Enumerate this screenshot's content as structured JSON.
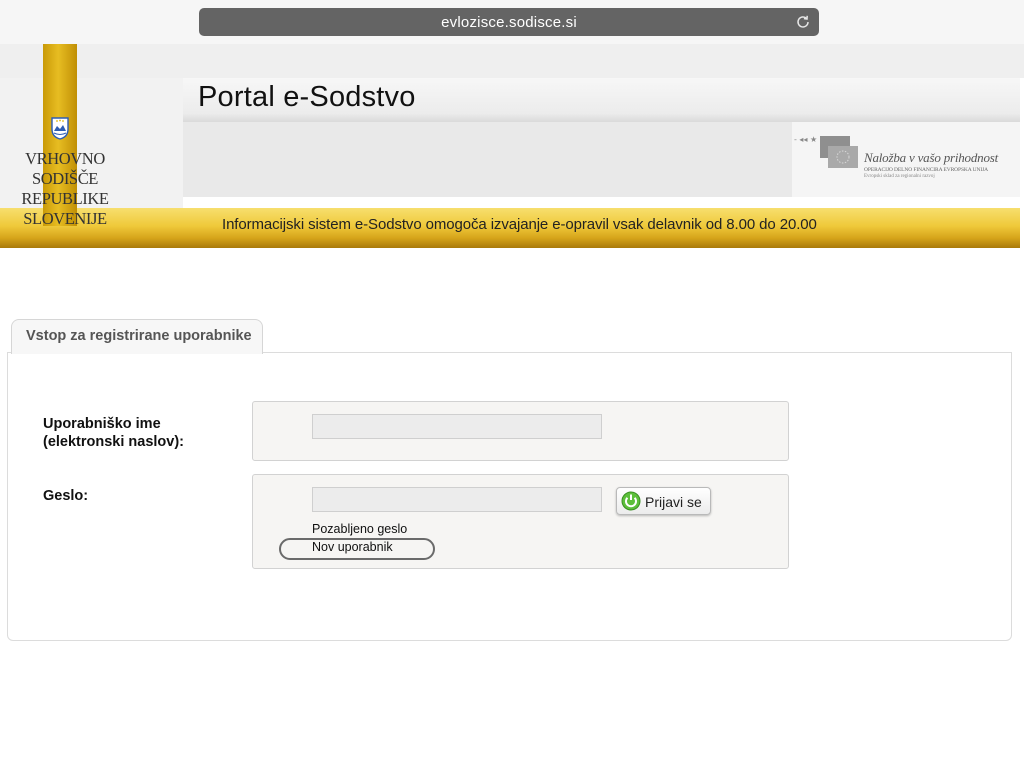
{
  "browser": {
    "url": "evlozisce.sodisce.si",
    "reload_icon": "reload-icon"
  },
  "header": {
    "title": "Portal e-Sodstvo",
    "court_line1": "VRHOVNO SODIŠČE",
    "court_line2": "REPUBLIKE SLOVENIJE",
    "eu_slogan": "Naložba v vašo prihodnost",
    "eu_sub1": "OPERACIJO DELNO FINANCIRA EVROPSKA UNIJA",
    "eu_sub2": "Evropski sklad za regionalni razvoj",
    "notice": "Informacijski sistem e-Sodstvo omogoča izvajanje e-opravil vsak delavnik od 8.00 do 20.00",
    "colors": {
      "gold": "#e7bd22",
      "gold_bar": "#efc93a"
    }
  },
  "login": {
    "tab_label": "Vstop za registrirane uporabnike",
    "username_label_line1": "Uporabniško ime",
    "username_label_line2": "(elektronski naslov):",
    "username_value": "",
    "password_label": "Geslo:",
    "password_value": "",
    "login_button": "Prijavi se",
    "login_icon": "power-icon",
    "forgot_password": "Pozabljeno geslo",
    "new_user": "Nov uporabnik"
  }
}
